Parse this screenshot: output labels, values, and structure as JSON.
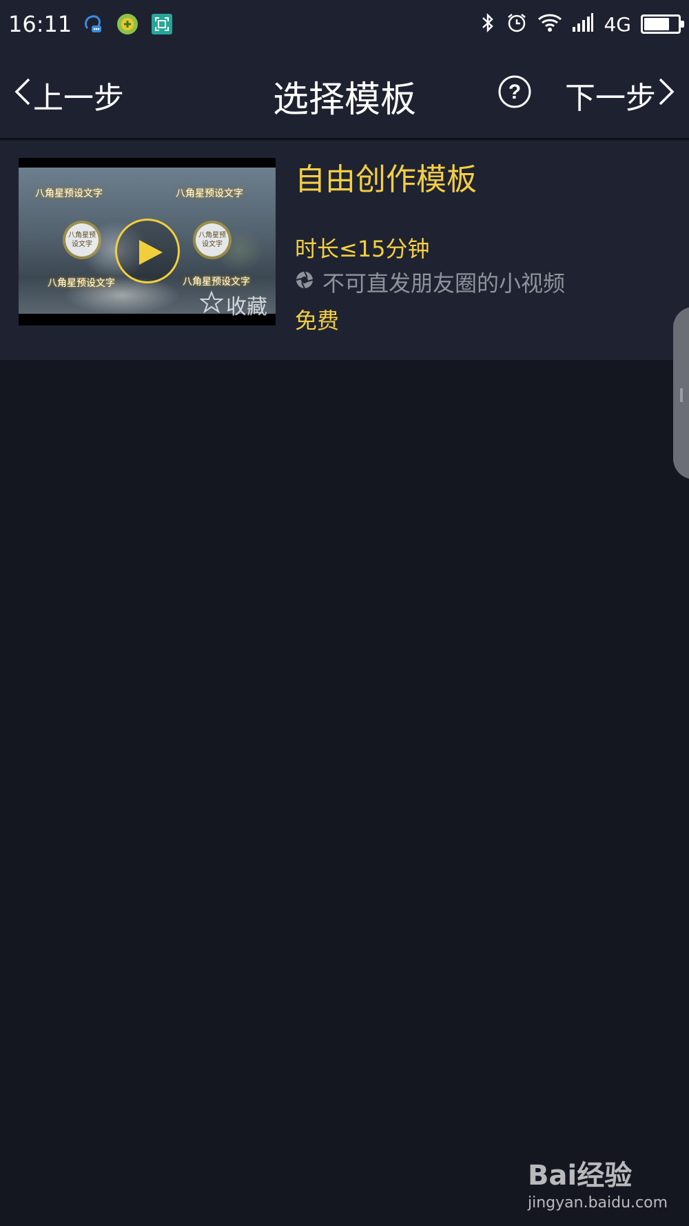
{
  "status_bar": {
    "time": "16:11",
    "network": "4G",
    "battery_level": 0.75,
    "icons": [
      "chat-assistant-icon",
      "360-security-icon",
      "screenshot-icon",
      "bluetooth-icon",
      "alarm-icon",
      "wifi-icon",
      "signal-icon",
      "battery-icon"
    ]
  },
  "nav": {
    "back_label": "上一步",
    "title": "选择模板",
    "help_icon": "question-circle-icon",
    "next_label": "下一步"
  },
  "template": {
    "title": "自由创作模板",
    "duration": "时长≤15分钟",
    "note": "不可直发朋友圈的小视频",
    "price": "免费",
    "favorite_label": "收藏",
    "thumbnail_text": {
      "top_left": "八角星预设文字",
      "top_right": "八角星预设文字",
      "circle_left": "八角星预设文字",
      "circle_right": "八角星预设文字",
      "bottom_left": "八角星预设文字",
      "bottom_right": "八角星预设文字"
    }
  },
  "watermark": {
    "logo_text": "Bai经验",
    "url": "jingyan.baidu.com"
  },
  "colors": {
    "accent": "#f4cf43",
    "background": "#141720",
    "header": "#1e2230",
    "card": "#1f2331",
    "muted_text": "#8e939c"
  }
}
